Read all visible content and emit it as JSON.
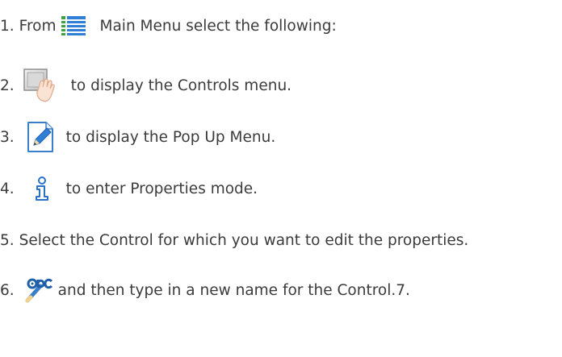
{
  "steps": [
    {
      "number": "1.",
      "text_before": "From",
      "icon": "main-menu-icon",
      "text": "Main Menu select the following:"
    },
    {
      "number": "2.",
      "icon": "controls-hand-icon",
      "text": "to display the Controls menu."
    },
    {
      "number": "3.",
      "icon": "edit-pencil-icon",
      "text": "to display the Pop Up Menu."
    },
    {
      "number": "4.",
      "icon": "info-icon",
      "text": "to enter Properties mode."
    },
    {
      "number": "5.",
      "text": "Select the Control for which you want to edit the properties."
    },
    {
      "number": "6.",
      "icon": "rename-abc-icon",
      "text": "and then type in a new name for the Control.7."
    }
  ],
  "colors": {
    "text": "#3b3b3b",
    "menu_icon_blue": "#2f7fd6",
    "menu_icon_green": "#3ea33e",
    "info_blue": "#2a72c8"
  }
}
